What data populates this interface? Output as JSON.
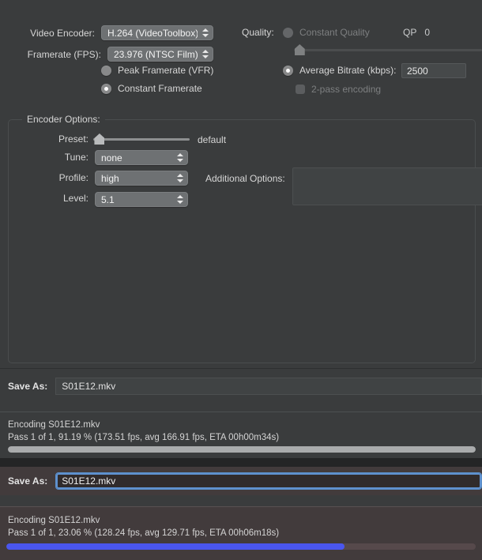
{
  "settings": {
    "video_encoder": {
      "label": "Video Encoder:",
      "value": "H.264 (VideoToolbox)"
    },
    "framerate": {
      "label": "Framerate (FPS):",
      "value": "23.976 (NTSC Film)"
    },
    "peak_framerate": {
      "label": "Peak Framerate (VFR)",
      "selected": false
    },
    "constant_framerate": {
      "label": "Constant Framerate",
      "selected": true
    },
    "quality": {
      "label": "Quality:",
      "constant_quality_label": "Constant Quality",
      "constant_quality_selected": false,
      "qp_label": "QP",
      "qp_value": "0",
      "slider_percent": 2
    },
    "average_bitrate": {
      "label": "Average Bitrate (kbps):",
      "selected": true,
      "value": "2500"
    },
    "two_pass": {
      "label": "2-pass encoding",
      "checked": false
    },
    "encoder_options": {
      "title": "Encoder Options:",
      "preset": {
        "label": "Preset:",
        "value": "default",
        "slider_percent": 2
      },
      "tune": {
        "label": "Tune:",
        "value": "none"
      },
      "profile": {
        "label": "Profile:",
        "value": "high"
      },
      "level": {
        "label": "Level:",
        "value": "5.1"
      },
      "additional_options": {
        "label": "Additional Options:",
        "value": ""
      }
    }
  },
  "job_top": {
    "save_as_label": "Save As:",
    "save_as_value": "S01E12.mkv",
    "encoding_line": "Encoding S01E12.mkv",
    "progress_line": "Pass 1 of 1, 91.19 % (173.51 fps, avg 166.91 fps, ETA 00h00m34s)",
    "progress_percent": 100,
    "progress_color": "#a9abac"
  },
  "job_bottom": {
    "save_as_label": "Save As:",
    "save_as_value": "S01E12.mkv",
    "encoding_line": "Encoding S01E12.mkv",
    "progress_line": "Pass 1 of 1, 23.06 % (128.24 fps, avg 129.71 fps, ETA 00h06m18s)",
    "progress_percent": 72,
    "progress_color": "#4a56ee"
  },
  "colors": {
    "window_bg": "#3a3c3d",
    "active_panel_bg": "#423b3c",
    "accent_blue": "#4a56ee",
    "focus_ring": "#5f91cf"
  }
}
